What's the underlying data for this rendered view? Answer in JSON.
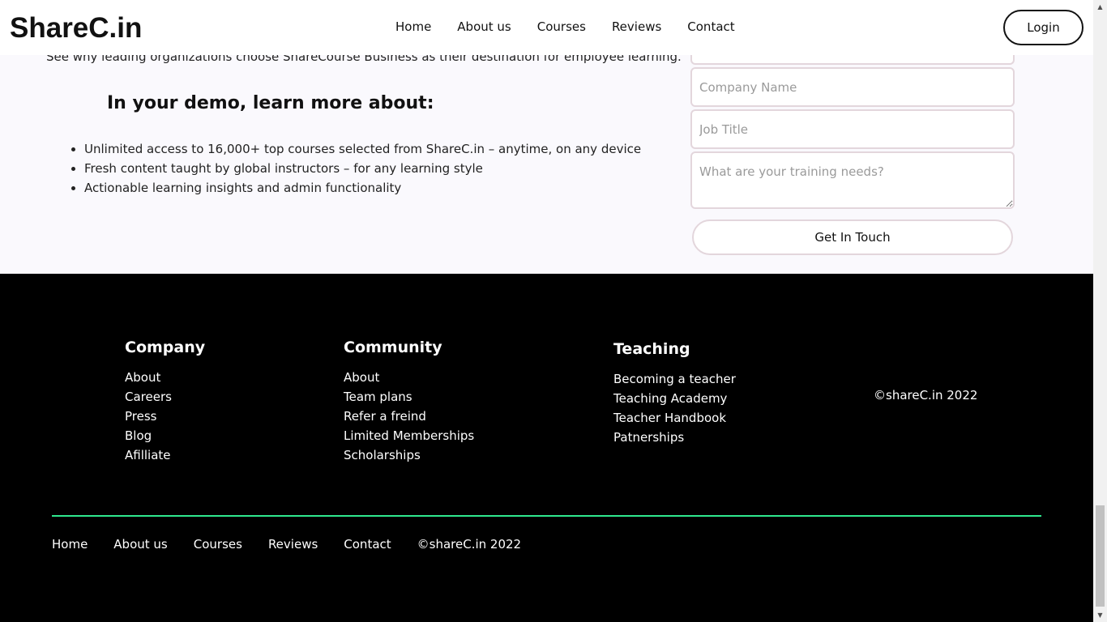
{
  "navbar": {
    "logo": "ShareC.in",
    "links": [
      "Home",
      "About us",
      "Courses",
      "Reviews",
      "Contact"
    ],
    "login_label": "Login"
  },
  "demo": {
    "intro": "See why leading organizations choose ShareCourse Business as their destination for employee learning.",
    "heading": "In your demo, learn more about:",
    "bullets": [
      "Unlimited access to 16,000+ top courses selected from ShareC.in – anytime, on any device",
      "Fresh content taught by global instructors – for any learning style",
      "Actionable learning insights and admin functionality"
    ]
  },
  "form": {
    "company_placeholder": "Company Name",
    "job_placeholder": "Job Title",
    "needs_placeholder": "What are your training needs?",
    "submit_label": "Get In Touch"
  },
  "footer": {
    "company": {
      "title": "Company",
      "links": [
        "About",
        "Careers",
        "Press",
        "Blog",
        "Afilliate"
      ]
    },
    "community": {
      "title": "Community",
      "links": [
        "About",
        "Team plans",
        "Refer a freind",
        "Limited Memberships",
        "Scholarships"
      ]
    },
    "teaching": {
      "title": "Teaching",
      "links": [
        "Becoming a teacher",
        "Teaching Academy",
        "Teacher Handbook",
        "Patnerships"
      ]
    },
    "copyright": "©shareC.in 2022",
    "bottom_links": [
      "Home",
      "About us",
      "Courses",
      "Reviews",
      "Contact"
    ],
    "bottom_copyright": "©shareC.in 2022",
    "accent_color": "#2ee88e"
  }
}
